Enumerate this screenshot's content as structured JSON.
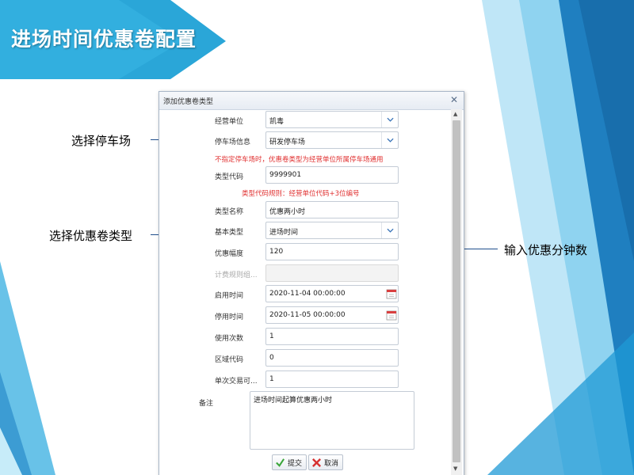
{
  "slide": {
    "title": "进场时间优惠卷配置",
    "callouts": {
      "select_parking": "选择停车场",
      "select_coupon_type": "选择优惠卷类型",
      "enter_minutes": "输入优惠分钟数"
    }
  },
  "dialog": {
    "title": "添加优惠卷类型",
    "close_icon": "close-icon",
    "fields": {
      "operator": {
        "label": "经营单位",
        "value": "凯毒"
      },
      "parking": {
        "label": "停车场信息",
        "value": "研发停车场"
      },
      "type_code": {
        "label": "类型代码",
        "value": "9999901"
      },
      "type_name": {
        "label": "类型名称",
        "value": "优惠两小时"
      },
      "base_type": {
        "label": "基本类型",
        "value": "进场时间"
      },
      "discount": {
        "label": "优惠幅度",
        "value": "120"
      },
      "billing_group": {
        "label": "计费规则组...",
        "value": ""
      },
      "start_time": {
        "label": "启用时间",
        "value": "2020-11-04 00:00:00"
      },
      "stop_time": {
        "label": "停用时间",
        "value": "2020-11-05 00:00:00"
      },
      "use_count": {
        "label": "使用次数",
        "value": "1"
      },
      "area_code": {
        "label": "区域代码",
        "value": "0"
      },
      "single_trade": {
        "label": "单次交易可...",
        "value": "1"
      },
      "note": {
        "label": "备注",
        "value": "进场时间起算优惠两小时"
      }
    },
    "hints": {
      "parking_hint": "不指定停车场时，优惠卷类型为经营单位所属停车场通用",
      "code_hint": "类型代码规则：经营单位代码+3位编号"
    },
    "buttons": {
      "submit": "提交",
      "cancel": "取消"
    }
  },
  "colors": {
    "accent_blue": "#2aa6d8",
    "hint_red": "#e03030",
    "callout_line": "#1f4e8c",
    "submit_check": "#3aa63a",
    "cancel_x": "#d63030"
  }
}
